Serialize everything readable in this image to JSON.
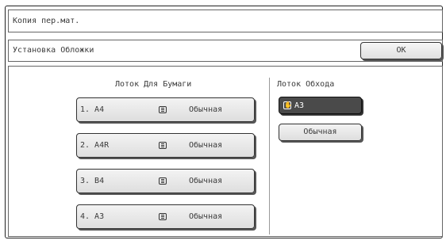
{
  "window": {
    "title": "Копия пер.мат."
  },
  "header": {
    "subtitle": "Установка Обложки",
    "ok_label": "OK"
  },
  "tray": {
    "heading": "Лоток Для Бумаги",
    "items": [
      {
        "size": "1. A4",
        "type": "Обычная",
        "icon": "paper-tray-icon"
      },
      {
        "size": "2. A4R",
        "type": "Обычная",
        "icon": "paper-tray-icon"
      },
      {
        "size": "3. B4",
        "type": "Обычная",
        "icon": "paper-tray-icon"
      },
      {
        "size": "4. A3",
        "type": "Обычная",
        "icon": "paper-tray-icon"
      }
    ]
  },
  "bypass": {
    "heading": "Лоток Обхода",
    "size": "A3",
    "type": "Обычная",
    "icon": "bypass-hand-icon",
    "selected_color": "#4a4a4a"
  }
}
